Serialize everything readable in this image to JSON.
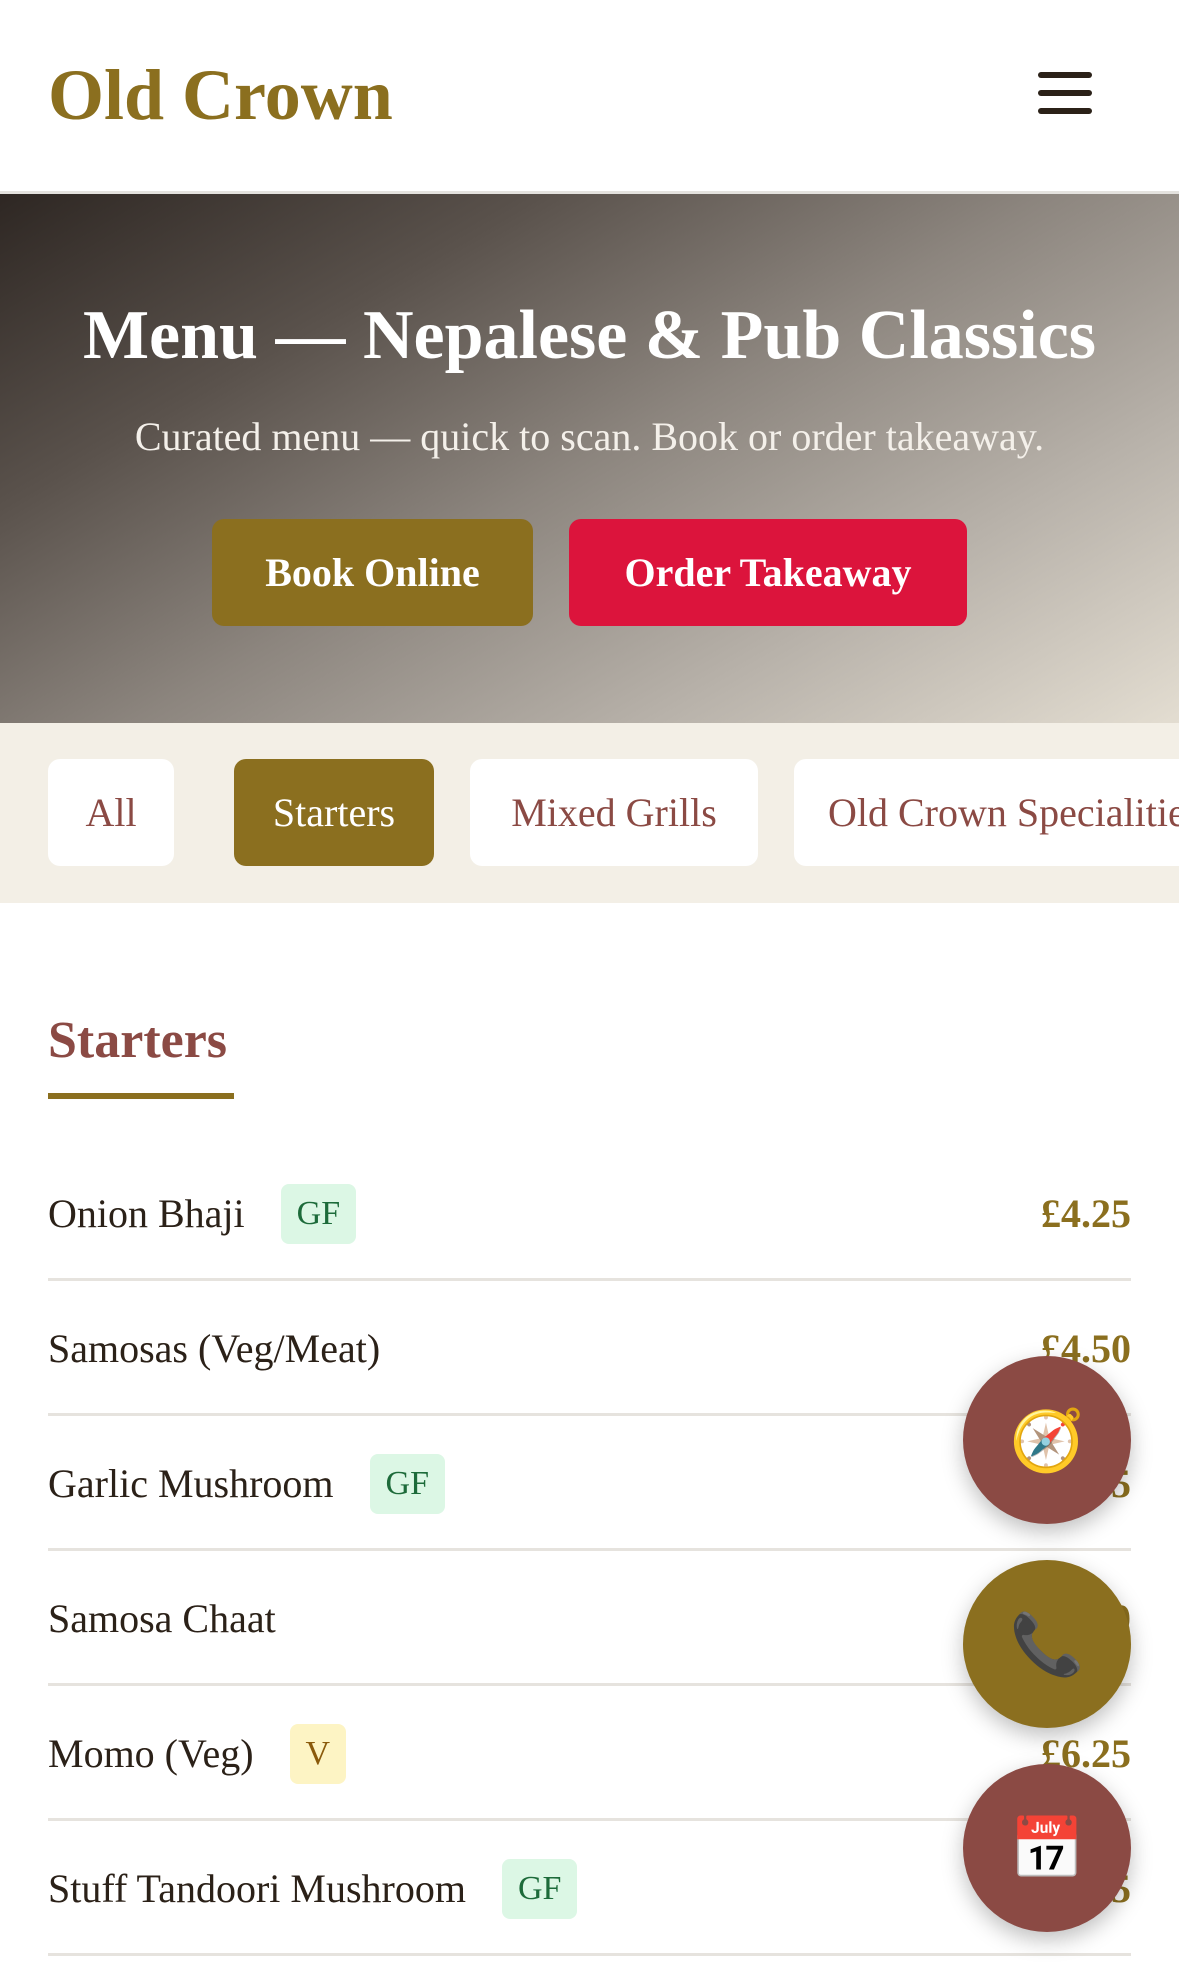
{
  "header": {
    "brand": "Old Crown",
    "menu_icon": "hamburger-menu-icon"
  },
  "hero": {
    "title": "Menu — Nepalese & Pub Classics",
    "subtitle": "Curated menu — quick to scan. Book or order takeaway.",
    "book_label": "Book Online",
    "order_label": "Order Takeaway"
  },
  "tabs": [
    {
      "label": "All",
      "active": false
    },
    {
      "label": "Starters",
      "active": true
    },
    {
      "label": "Mixed Grills",
      "active": false
    },
    {
      "label": "Old Crown Specialities",
      "active": false
    }
  ],
  "section": {
    "title": "Starters"
  },
  "items": [
    {
      "name": "Onion Bhaji",
      "badge": "GF",
      "price": "£4.25"
    },
    {
      "name": "Samosas (Veg/Meat)",
      "badge": "",
      "price": "£4.50"
    },
    {
      "name": "Garlic Mushroom",
      "badge": "GF",
      "price": "£4.95"
    },
    {
      "name": "Samosa Chaat",
      "badge": "",
      "price": "£5.50"
    },
    {
      "name": "Momo (Veg)",
      "badge": "V",
      "price": "£6.25"
    },
    {
      "name": "Stuff Tandoori Mushroom",
      "badge": "GF",
      "price": "£5.95"
    }
  ],
  "fabs": {
    "compass_glyph": "🧭",
    "phone_glyph": "📞",
    "calendar_glyph": "📅"
  },
  "colors": {
    "brand_gold": "#8b6f1f",
    "accent_red": "#dc143c",
    "maroon": "#8b4a44",
    "tabs_bg": "#f3efe6"
  }
}
